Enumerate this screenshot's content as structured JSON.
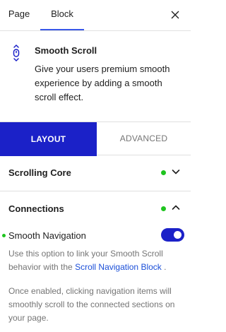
{
  "inspector_tabs": {
    "page_label": "Page",
    "block_label": "Block",
    "close_icon": "close-icon"
  },
  "block": {
    "icon": "smooth-scroll-icon",
    "title": "Smooth Scroll",
    "description": "Give your users premium smooth experience by adding a smooth scroll effect."
  },
  "panel_tabs": {
    "layout_label": "LAYOUT",
    "advanced_label": "ADVANCED"
  },
  "sections": {
    "scrolling_core": {
      "title": "Scrolling Core",
      "expanded": false,
      "status_color": "#1fc41f"
    },
    "connections": {
      "title": "Connections",
      "expanded": true,
      "status_color": "#1fc41f"
    }
  },
  "smooth_navigation": {
    "label": "Smooth Navigation",
    "enabled": true,
    "help_text_before": "Use this option to link your Smooth Scroll behavior with the ",
    "help_link": "Scroll Navigation Block",
    "help_text_after": " .",
    "help_text_2": "Once enabled, clicking navigation items will smoothly scroll to the connected sections on your page."
  },
  "colors": {
    "accent": "#1b21c8",
    "status_green": "#1fc41f",
    "link": "#1b4fd8",
    "muted_text": "#757575"
  }
}
